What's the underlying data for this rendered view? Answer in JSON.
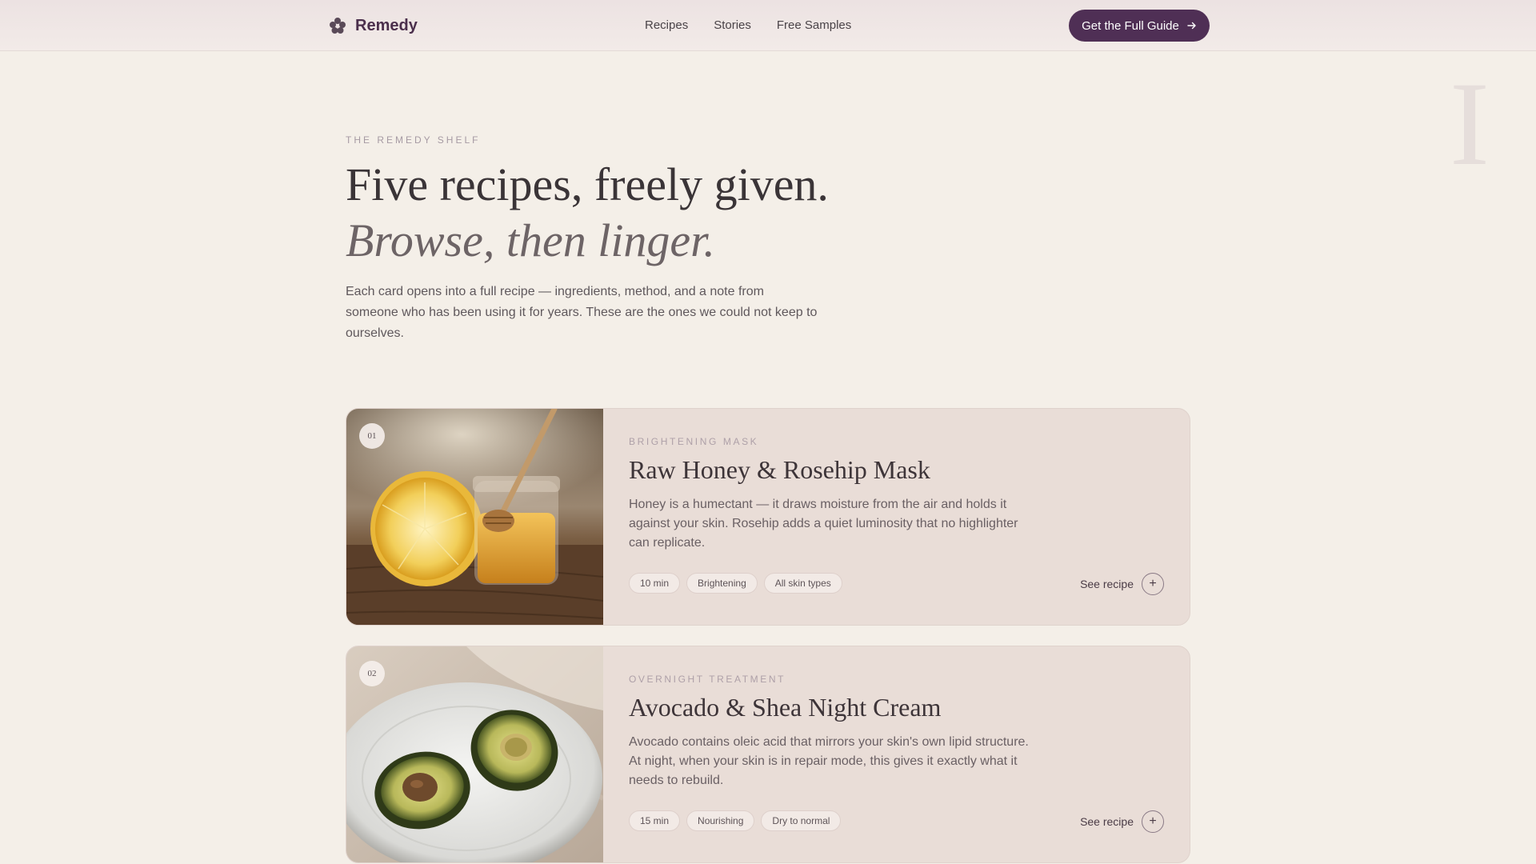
{
  "header": {
    "brand": "Remedy",
    "nav": [
      "Recipes",
      "Stories",
      "Free Samples"
    ],
    "cta_label": "Get the Full Guide",
    "cta_color": "#4f2f55"
  },
  "decor": {
    "roman": "I"
  },
  "hero": {
    "eyebrow": "THE REMEDY SHELF",
    "title": "Five recipes, freely given.",
    "subtitle": "Browse, then linger.",
    "description": "Each card opens into a full recipe — ingredients, method, and a note from someone who has been using it for years. These are the ones we could not keep to ourselves."
  },
  "recipes": [
    {
      "number": "01",
      "category": "BRIGHTENING MASK",
      "title": "Raw Honey & Rosehip Mask",
      "description": "Honey is a humectant — it draws moisture from the air and holds it against your skin. Rosehip adds a quiet luminosity that no highlighter can replicate.",
      "tags": [
        "10 min",
        "Brightening",
        "All skin types"
      ],
      "cta": "See recipe",
      "image_icon": "honey-lemon-photo"
    },
    {
      "number": "02",
      "category": "OVERNIGHT TREATMENT",
      "title": "Avocado & Shea Night Cream",
      "description": "Avocado contains oleic acid that mirrors your skin's own lipid structure. At night, when your skin is in repair mode, this gives it exactly what it needs to rebuild.",
      "tags": [
        "15 min",
        "Nourishing",
        "Dry to normal"
      ],
      "cta": "See recipe",
      "image_icon": "avocado-plate-photo"
    }
  ],
  "colors": {
    "background": "#f4efe8",
    "card": "#e9ddd7",
    "brand": "#4b2f4c"
  }
}
